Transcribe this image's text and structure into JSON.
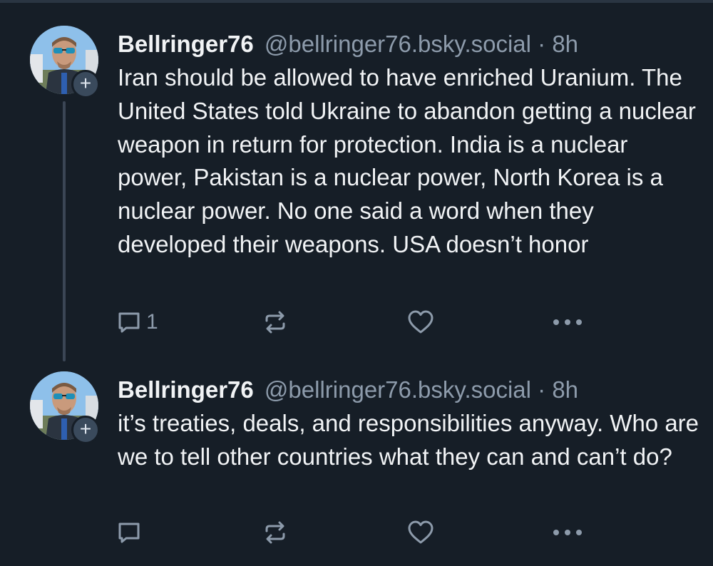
{
  "posts": [
    {
      "author": {
        "display_name": "Bellringer76",
        "handle": "@bellringer76.bsky.social"
      },
      "separator": "·",
      "time": "8h",
      "text": "Iran should be allowed to have enriched Uranium. The United States told Ukraine to abandon getting a nuclear weapon in return for protection. India is a nuclear power, Pakistan is a nuclear power, North Korea is a nuclear power. No one said a word when they developed their weapons. USA doesn’t honor",
      "reply_count": "1",
      "icons": {
        "reply": "reply-icon",
        "repost": "repost-icon",
        "like": "heart-icon",
        "more": "more-icon",
        "follow": "plus-icon"
      }
    },
    {
      "author": {
        "display_name": "Bellringer76",
        "handle": "@bellringer76.bsky.social"
      },
      "separator": "·",
      "time": "8h",
      "text": "it’s treaties, deals, and responsibilities anyway. Who are we to tell other countries what they can and can’t do?",
      "reply_count": "",
      "icons": {
        "reply": "reply-icon",
        "repost": "repost-icon",
        "like": "heart-icon",
        "more": "more-icon",
        "follow": "plus-icon"
      }
    }
  ],
  "colors": {
    "background": "#161e27",
    "text": "#f1f3f5",
    "muted": "#8d9bab",
    "thread_line": "#3b4655"
  }
}
